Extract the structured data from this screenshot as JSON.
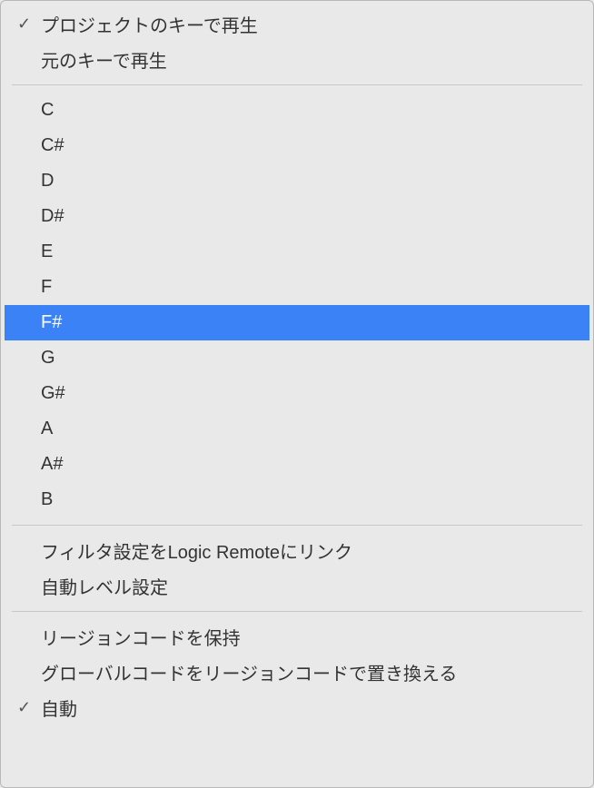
{
  "menu": {
    "section1": [
      {
        "label": "プロジェクトのキーで再生",
        "checked": true,
        "highlighted": false
      },
      {
        "label": "元のキーで再生",
        "checked": false,
        "highlighted": false
      }
    ],
    "section2": [
      {
        "label": "C",
        "checked": false,
        "highlighted": false
      },
      {
        "label": "C#",
        "checked": false,
        "highlighted": false
      },
      {
        "label": "D",
        "checked": false,
        "highlighted": false
      },
      {
        "label": "D#",
        "checked": false,
        "highlighted": false
      },
      {
        "label": "E",
        "checked": false,
        "highlighted": false
      },
      {
        "label": "F",
        "checked": false,
        "highlighted": false
      },
      {
        "label": "F#",
        "checked": false,
        "highlighted": true
      },
      {
        "label": "G",
        "checked": false,
        "highlighted": false
      },
      {
        "label": "G#",
        "checked": false,
        "highlighted": false
      },
      {
        "label": "A",
        "checked": false,
        "highlighted": false
      },
      {
        "label": "A#",
        "checked": false,
        "highlighted": false
      },
      {
        "label": "B",
        "checked": false,
        "highlighted": false
      }
    ],
    "section3": [
      {
        "label": "フィルタ設定をLogic Remoteにリンク",
        "checked": false,
        "highlighted": false
      },
      {
        "label": "自動レベル設定",
        "checked": false,
        "highlighted": false
      }
    ],
    "section4": [
      {
        "label": "リージョンコードを保持",
        "checked": false,
        "highlighted": false
      },
      {
        "label": "グローバルコードをリージョンコードで置き換える",
        "checked": false,
        "highlighted": false
      },
      {
        "label": "自動",
        "checked": true,
        "highlighted": false
      }
    ]
  },
  "checkmark_glyph": "✓"
}
